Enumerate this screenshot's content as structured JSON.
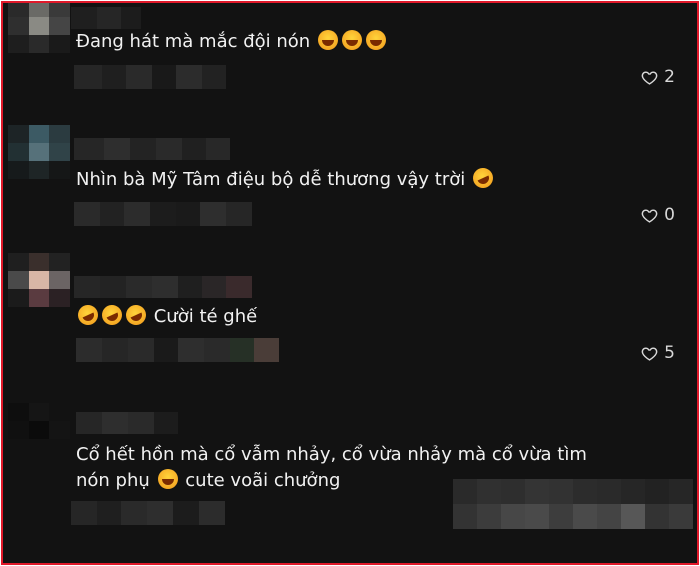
{
  "comments": [
    {
      "text": "Đang hát mà mắc đội nón",
      "emojis": [
        "laughing-face",
        "laughing-face",
        "laughing-face"
      ],
      "likes": "2"
    },
    {
      "text": "Nhìn bà Mỹ Tâm điệu bộ dễ thương vậy trời",
      "emojis": [
        "squinting-tongue-face"
      ],
      "likes": "0"
    },
    {
      "text": "Cười té ghế",
      "emojis": [
        "rolling-on-floor-laughing-face",
        "rolling-on-floor-laughing-face",
        "rolling-on-floor-laughing-face"
      ],
      "likes": "5"
    },
    {
      "text_line1": "Cổ hết hồn mà cổ vẫm nhảy, cổ vừa nhảy mà cổ vừa tìm",
      "text_line2a": "nón phụ",
      "text_line2b": "cute voãi chưởng",
      "emojis": [
        "laughing-face"
      ]
    }
  ],
  "colors": {
    "background": "#121212",
    "border": "#e0192a",
    "text": "#f1f1f1"
  }
}
